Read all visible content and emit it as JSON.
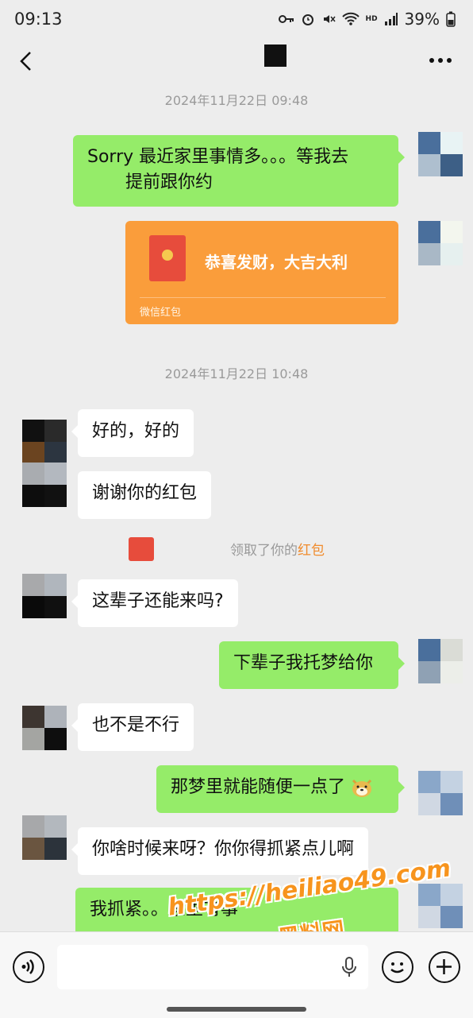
{
  "status_bar": {
    "time": "09:13",
    "battery": "39%",
    "hd": "HD"
  },
  "messages": [
    {
      "type": "timestamp",
      "text": "2024年11月22日 09:48"
    },
    {
      "type": "out",
      "lines": [
        "Sorry 最近家里事情多。。。等我去",
        "提前跟你约"
      ]
    },
    {
      "type": "red_packet",
      "title": "恭喜发财，大吉大利",
      "label": "微信红包"
    },
    {
      "type": "timestamp",
      "text": "2024年11月22日 10:48"
    },
    {
      "type": "in",
      "text": "好的，好的"
    },
    {
      "type": "in",
      "text": "谢谢你的红包"
    },
    {
      "type": "system",
      "text": "领取了你的",
      "link": "红包"
    },
    {
      "type": "in",
      "text": "这辈子还能来吗?"
    },
    {
      "type": "out",
      "text": "下辈子我托梦给你"
    },
    {
      "type": "in",
      "text": "也不是不行"
    },
    {
      "type": "out",
      "text": "那梦里就能随便一点了",
      "emoji": "doge-emoji"
    },
    {
      "type": "in",
      "text": "你啥时候来呀？你你得抓紧点儿啊"
    },
    {
      "type": "out",
      "text": "我抓紧。。家里有事"
    }
  ],
  "watermark": {
    "url": "https://heiliao49.com",
    "name": "黑料网"
  },
  "colors": {
    "accent_green": "#95ec69",
    "red_packet": "#fa9d3b",
    "link": "#f08b2c"
  }
}
